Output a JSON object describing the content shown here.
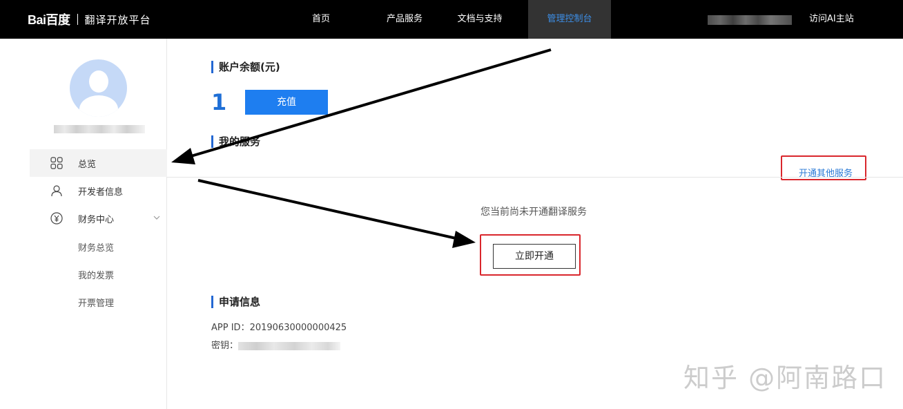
{
  "header": {
    "logo_text": "Bai百度",
    "platform_title": "翻译开放平台",
    "nav": [
      {
        "label": "首页",
        "active": false
      },
      {
        "label": "产品服务",
        "active": false
      },
      {
        "label": "文档与支持",
        "active": false
      },
      {
        "label": "管理控制台",
        "active": true
      }
    ],
    "visit_ai_label": "访问AI主站"
  },
  "sidebar": {
    "items": [
      {
        "label": "总览",
        "icon": "grid-icon",
        "active": true
      },
      {
        "label": "开发者信息",
        "icon": "user-icon",
        "active": false
      },
      {
        "label": "财务中心",
        "icon": "yuan-icon",
        "active": false,
        "expanded": true
      }
    ],
    "sub_items": [
      {
        "label": "财务总览"
      },
      {
        "label": "我的发票"
      },
      {
        "label": "开票管理"
      }
    ]
  },
  "main": {
    "balance_title": "账户余额(元)",
    "balance_value": "1",
    "recharge_label": "充值",
    "services_title": "我的服务",
    "open_other_label": "开通其他服务",
    "no_service_text": "您当前尚未开通翻译服务",
    "open_now_label": "立即开通",
    "apply_title": "申请信息",
    "app_id_label": "APP ID：",
    "app_id_value": "20190630000000425",
    "secret_label": "密钥："
  },
  "watermark": "知乎 @阿南路口",
  "colors": {
    "topbar_bg": "#000000",
    "nav_active_bg": "#333333",
    "nav_active_text": "#3d8fe8",
    "primary": "#1e7ef0",
    "balance_text": "#1f6fd6",
    "highlight_box": "#d9262c",
    "link": "#2c7bd6"
  }
}
